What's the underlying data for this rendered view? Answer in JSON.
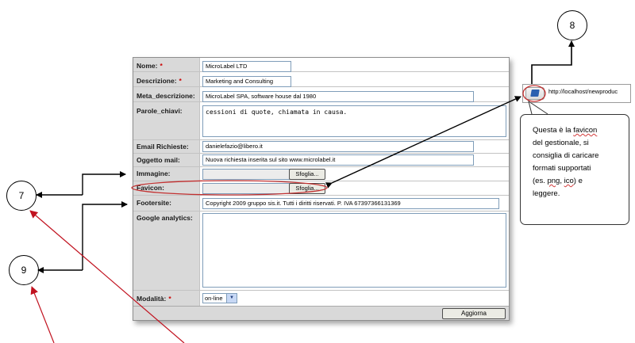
{
  "form": {
    "nome": {
      "label": "Nome:",
      "required": "*",
      "value": "MicroLabel LTD"
    },
    "descrizione": {
      "label": "Descrizione:",
      "required": "*",
      "value": "Marketing and Consulting"
    },
    "meta": {
      "label": "Meta_descrizione:",
      "value": "MicroLabel SPA, software house dal 1980"
    },
    "parole": {
      "label": "Parole_chiavi:",
      "value": "cessioni di quote, chiamata in causa."
    },
    "email": {
      "label": "Email Richieste:",
      "value": "danielefazio@libero.it"
    },
    "oggetto": {
      "label": "Oggetto mail:",
      "value": "Nuova richiesta inserita sul sito www.microlabel.it"
    },
    "immagine": {
      "label": "Immagine:",
      "button": "Sfoglia..."
    },
    "favicon": {
      "label": "Favicon:",
      "button": "Sfoglia..."
    },
    "footersite": {
      "label": "Footersite:",
      "value": "Copyright 2009 gruppo sis.it. Tutti i diritti riservati. P. IVA 67397366131369"
    },
    "analytics": {
      "label": "Google analytics:",
      "value": ""
    },
    "modalita": {
      "label": "Modalità:",
      "required": "*",
      "selected": "on-line"
    },
    "submit": "Aggiorna"
  },
  "browser": {
    "url": "http://localhost/newproduc"
  },
  "callouts": {
    "c7": "7",
    "c8": "8",
    "c9": "9"
  },
  "tooltip": {
    "line1_a": "Questa è la ",
    "line1_b": "favicon",
    "line2": "del gestionale, si",
    "line3": "consiglia di caricare",
    "line4": "formati supportati",
    "line5_a": "(es. ",
    "line5_b": "png",
    "line5_c": ", ",
    "line5_d": "ico",
    "line5_e": ") e",
    "line6": "leggere."
  },
  "colors": {
    "arrow_red": "#c1121f",
    "ellipse_red": "#c23030",
    "label_bg": "#d9d9d9"
  }
}
